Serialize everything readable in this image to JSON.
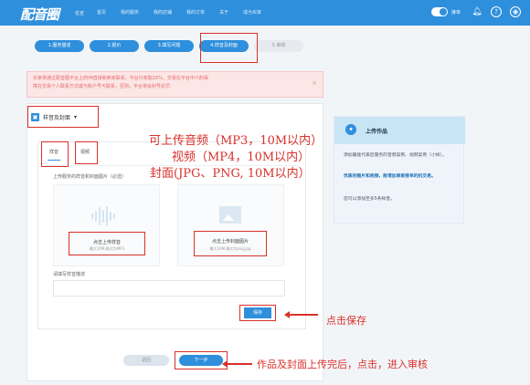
{
  "header": {
    "logo": "配音圈",
    "logo_sub": "名宣",
    "nav": [
      "首页",
      "我的服务",
      "我的店铺",
      "我的订单",
      "关于",
      "成为买家"
    ],
    "toggle_label": "接单",
    "bell_icon": "bell-icon",
    "help_icon": "help-circle-icon",
    "avatar_icon": "avatar-icon"
  },
  "steps": [
    "1.服务描述",
    "2.报价",
    "3.填写问题",
    "4.样音及封面",
    "5.审核"
  ],
  "warning": {
    "line1": "买家将通过配音圈平台上的IM直接和卖家联系，平台只收取20%，交易在平台中介的保",
    "line2": "障在交易个人联系方式或与账户号与联系，否则，平台将会封号处罚",
    "close": "×"
  },
  "section": {
    "title": "样音及封面",
    "caret": "▾"
  },
  "tabs": {
    "audio": "样音",
    "video": "视频"
  },
  "upload": {
    "label": "上传服务的样音和封面图片（必选）",
    "audio_main": "点击上传样音",
    "audio_sub": "最大10M,格式为MP3",
    "cover_main": "点击上传封面图片",
    "cover_sub": "最大10M,格式为png,jpg",
    "desc_label": "请填写样音描述"
  },
  "buttons": {
    "save": "保存",
    "back": "返回",
    "next": "下一步"
  },
  "side": {
    "title": "上传作品",
    "p1": "添加最能代表您服务的音频案例、视频案例（小样）。",
    "p2": "优质的图片和视频，能增加商家接单的机交易。",
    "p3": "您可以添加至多5条样音。"
  },
  "annotations": {
    "line1": "可上传音频（MP3，10M以内）",
    "line2": "视频（MP4，10M以内）",
    "line3": "封面(JPG、PNG, 10M以内）",
    "save_hint": "点击保存",
    "next_hint": "作品及封面上传完后，点击，进入审核"
  },
  "colors": {
    "brand": "#2e8fdc",
    "annotation": "#d9302a",
    "warning_bg": "#fde6e6"
  }
}
